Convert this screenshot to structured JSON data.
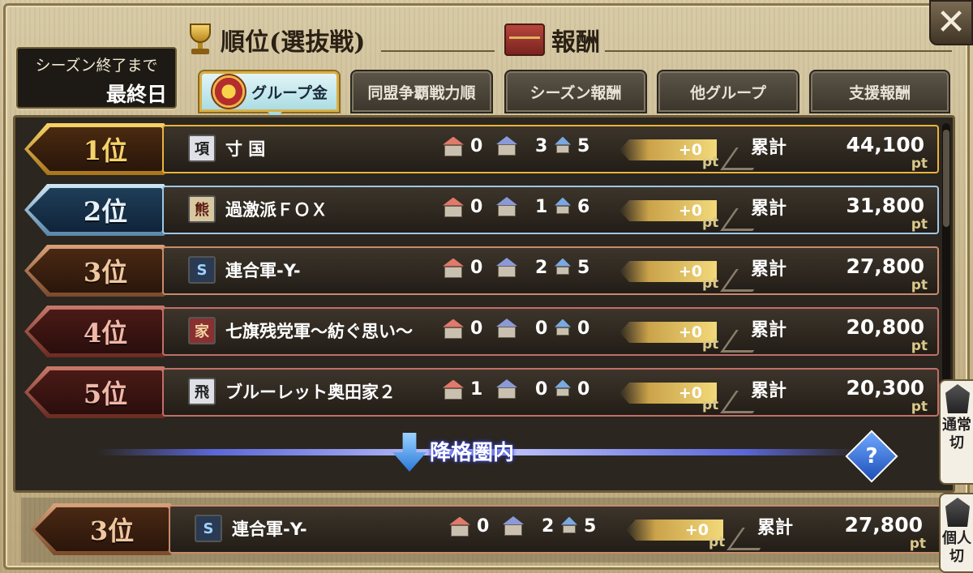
{
  "header": {
    "season_label": "シーズン終了まで",
    "season_value": "最終日",
    "ranking_title": "順位(選抜戦)",
    "reward_title": "報酬",
    "close_label": "✕"
  },
  "tabs": [
    {
      "label": "グループ金",
      "active": true
    },
    {
      "label": "同盟争覇戦力順",
      "active": false
    },
    {
      "label": "シーズン報酬",
      "active": false
    },
    {
      "label": "他グループ",
      "active": false
    },
    {
      "label": "支援報酬",
      "active": false
    }
  ],
  "rankings": [
    {
      "rank": "1位",
      "crest": "項",
      "name": "寸 国",
      "stat_a": "0",
      "stat_b": "3",
      "stat_c": "5",
      "gain": "+0",
      "gain_unit": "pt",
      "total_label": "累計",
      "total": "44,100",
      "total_unit": "pt",
      "tier": "gold"
    },
    {
      "rank": "2位",
      "crest": "熊",
      "name": "過激派ＦＯＸ",
      "stat_a": "0",
      "stat_b": "1",
      "stat_c": "6",
      "gain": "+0",
      "gain_unit": "pt",
      "total_label": "累計",
      "total": "31,800",
      "total_unit": "pt",
      "tier": "blue"
    },
    {
      "rank": "3位",
      "crest": "S",
      "name": "連合軍-Y-",
      "stat_a": "0",
      "stat_b": "2",
      "stat_c": "5",
      "gain": "+0",
      "gain_unit": "pt",
      "total_label": "累計",
      "total": "27,800",
      "total_unit": "pt",
      "tier": "bronze"
    },
    {
      "rank": "4位",
      "crest": "家",
      "name": "七旗残党軍～紡ぐ思い～",
      "stat_a": "0",
      "stat_b": "0",
      "stat_c": "0",
      "gain": "+0",
      "gain_unit": "pt",
      "total_label": "累計",
      "total": "20,800",
      "total_unit": "pt",
      "tier": "red"
    },
    {
      "rank": "5位",
      "crest": "飛",
      "name": "ブルーレット奥田家２",
      "stat_a": "1",
      "stat_b": "0",
      "stat_c": "0",
      "gain": "+0",
      "gain_unit": "pt",
      "total_label": "累計",
      "total": "20,300",
      "total_unit": "pt",
      "tier": "red"
    }
  ],
  "demotion": {
    "label": "降格圏内",
    "help": "?"
  },
  "self_row": {
    "rank": "3位",
    "crest": "S",
    "name": "連合軍-Y-",
    "stat_a": "0",
    "stat_b": "2",
    "stat_c": "5",
    "gain": "+0",
    "gain_unit": "pt",
    "total_label": "累計",
    "total": "27,800",
    "total_unit": "pt"
  },
  "side_tabs": [
    {
      "line1": "通常",
      "line2": "切"
    },
    {
      "line1": "個人",
      "line2": "切"
    }
  ],
  "colors": {
    "gold_rim": "#e9b43a",
    "blue_rim": "#9fc7e6",
    "bronze_rim": "#c98b6b",
    "red_rim": "#c07068",
    "demotion": "#5a66d8"
  }
}
